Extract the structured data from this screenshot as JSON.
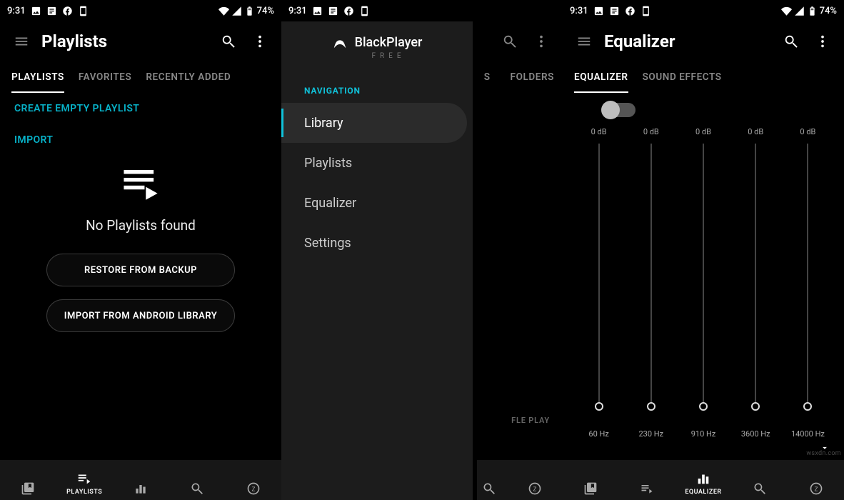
{
  "status": {
    "time": "9:31",
    "battery": "74%"
  },
  "phone1": {
    "title": "Playlists",
    "tabs": [
      "PLAYLISTS",
      "FAVORITES",
      "RECENTLY ADDED"
    ],
    "create": "CREATE EMPTY PLAYLIST",
    "import": "IMPORT",
    "empty": "No Playlists found",
    "restore": "RESTORE FROM BACKUP",
    "importlib": "IMPORT FROM ANDROID LIBRARY",
    "bottom_label": "PLAYLISTS"
  },
  "phone2": {
    "app": "BlackPlayer",
    "sub": "FREE",
    "nav_header": "NAVIGATION",
    "items": [
      "Library",
      "Playlists",
      "Equalizer",
      "Settings"
    ],
    "partial_tabs": [
      "S",
      "FOLDERS"
    ],
    "shuffle": "FLE PLAY"
  },
  "phone3": {
    "title": "Equalizer",
    "tabs": [
      "EQUALIZER",
      "SOUND EFFECTS"
    ],
    "bands": [
      {
        "db": "0 dB",
        "hz": "60 Hz"
      },
      {
        "db": "0 dB",
        "hz": "230 Hz"
      },
      {
        "db": "0 dB",
        "hz": "910 Hz"
      },
      {
        "db": "0 dB",
        "hz": "3600 Hz"
      },
      {
        "db": "0 dB",
        "hz": "14000 Hz"
      }
    ],
    "bottom_label": "EQUALIZER"
  },
  "watermark": "wsxdn.com"
}
